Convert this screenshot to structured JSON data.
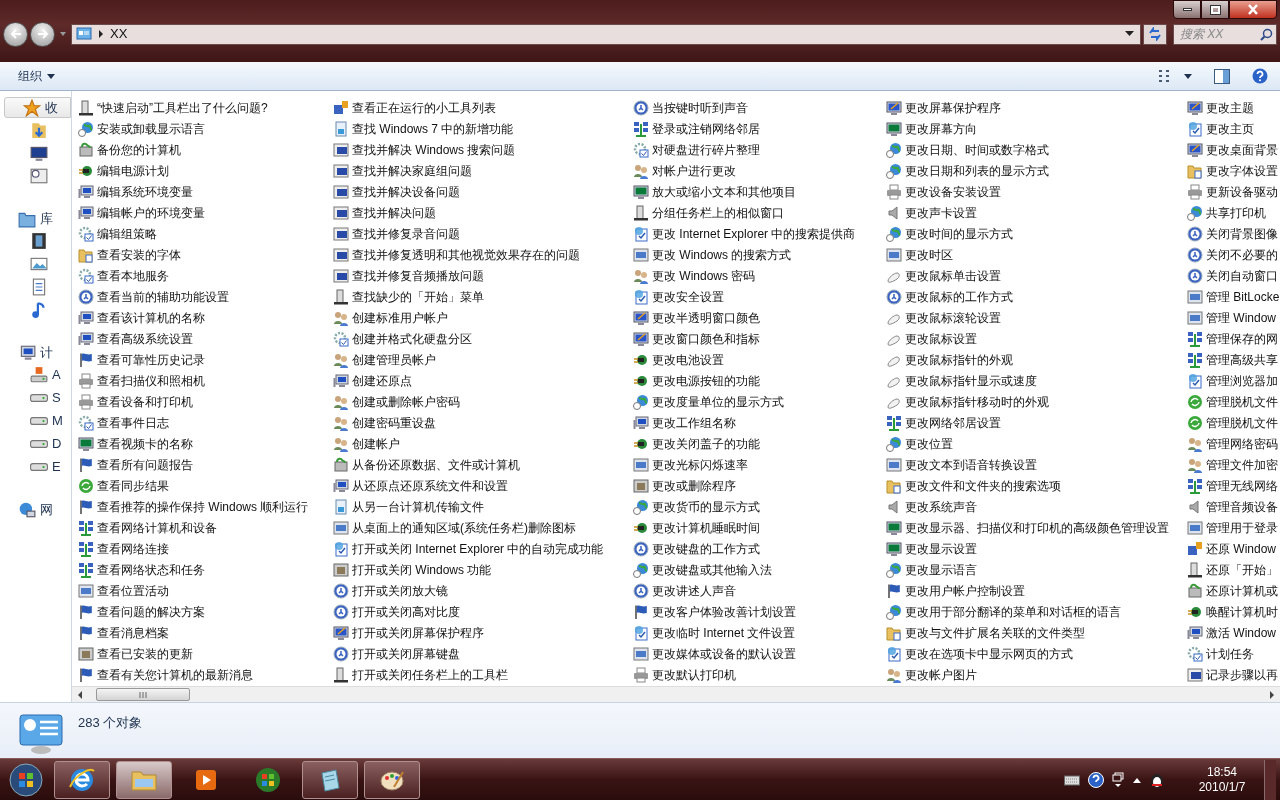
{
  "address_bar": {
    "path": "XX"
  },
  "search": {
    "placeholder": "搜索 XX"
  },
  "toolbar": {
    "organize": "组织"
  },
  "sidebar": [
    {
      "label": "收",
      "kind": "favorites",
      "selected": true,
      "children": [
        {
          "kind": "downloads"
        },
        {
          "kind": "desktop"
        },
        {
          "kind": "recent"
        }
      ]
    },
    {
      "label": "库",
      "kind": "library",
      "selected": false,
      "children": [
        {
          "kind": "videos"
        },
        {
          "kind": "pictures"
        },
        {
          "kind": "documents"
        },
        {
          "kind": "music"
        }
      ]
    },
    {
      "label": "计",
      "kind": "computer",
      "selected": false,
      "children": [
        {
          "kind": "system-drive",
          "label": "A"
        },
        {
          "kind": "drive",
          "label": "S"
        },
        {
          "kind": "drive",
          "label": "M"
        },
        {
          "kind": "drive",
          "label": "D"
        },
        {
          "kind": "drive",
          "label": "E"
        }
      ]
    },
    {
      "label": "网",
      "kind": "network",
      "selected": false
    }
  ],
  "columns": [
    [
      {
        "label": "“快速启动”工具栏出了什么问题?",
        "kind": "taskbar"
      },
      {
        "label": "安装或卸载显示语言",
        "kind": "globe"
      },
      {
        "label": "备份您的计算机",
        "kind": "backup"
      },
      {
        "label": "编辑电源计划",
        "kind": "power"
      },
      {
        "label": "编辑系统环境变量",
        "kind": "system"
      },
      {
        "label": "编辑帐户的环境变量",
        "kind": "system"
      },
      {
        "label": "编辑组策略",
        "kind": "admin"
      },
      {
        "label": "查看安装的字体",
        "kind": "folder"
      },
      {
        "label": "查看本地服务",
        "kind": "admin"
      },
      {
        "label": "查看当前的辅助功能设置",
        "kind": "access"
      },
      {
        "label": "查看该计算机的名称",
        "kind": "system"
      },
      {
        "label": "查看高级系统设置",
        "kind": "system"
      },
      {
        "label": "查看可靠性历史记录",
        "kind": "flag"
      },
      {
        "label": "查看扫描仪和照相机",
        "kind": "printer"
      },
      {
        "label": "查看设备和打印机",
        "kind": "printer"
      },
      {
        "label": "查看事件日志",
        "kind": "admin"
      },
      {
        "label": "查看视频卡的名称",
        "kind": "display"
      },
      {
        "label": "查看所有问题报告",
        "kind": "flag"
      },
      {
        "label": "查看同步结果",
        "kind": "sync"
      },
      {
        "label": "查看推荐的操作保持 Windows 顺利运行",
        "kind": "flag"
      },
      {
        "label": "查看网络计算机和设备",
        "kind": "network"
      },
      {
        "label": "查看网络连接",
        "kind": "network"
      },
      {
        "label": "查看网络状态和任务",
        "kind": "network"
      },
      {
        "label": "查看位置活动",
        "kind": "other"
      },
      {
        "label": "查看问题的解决方案",
        "kind": "flag"
      },
      {
        "label": "查看消息档案",
        "kind": "flag"
      },
      {
        "label": "查看已安装的更新",
        "kind": "programs"
      },
      {
        "label": "查看有关您计算机的最新消息",
        "kind": "flag"
      }
    ],
    [
      {
        "label": "查看正在运行的小工具列表",
        "kind": "gadgets"
      },
      {
        "label": "查找 Windows 7 中的新增功能",
        "kind": "document"
      },
      {
        "label": "查找并解决 Windows 搜索问题",
        "kind": "troubleshoot"
      },
      {
        "label": "查找并解决家庭组问题",
        "kind": "troubleshoot"
      },
      {
        "label": "查找并解决设备问题",
        "kind": "troubleshoot"
      },
      {
        "label": "查找并解决问题",
        "kind": "troubleshoot"
      },
      {
        "label": "查找并修复录音问题",
        "kind": "troubleshoot"
      },
      {
        "label": "查找并修复透明和其他视觉效果存在的问题",
        "kind": "troubleshoot"
      },
      {
        "label": "查找并修复音频播放问题",
        "kind": "troubleshoot"
      },
      {
        "label": "查找缺少的「开始」菜单",
        "kind": "taskbar"
      },
      {
        "label": "创建标准用户帐户",
        "kind": "users"
      },
      {
        "label": "创建并格式化硬盘分区",
        "kind": "admin"
      },
      {
        "label": "创建管理员帐户",
        "kind": "users"
      },
      {
        "label": "创建还原点",
        "kind": "system"
      },
      {
        "label": "创建或删除帐户密码",
        "kind": "users"
      },
      {
        "label": "创建密码重设盘",
        "kind": "users"
      },
      {
        "label": "创建帐户",
        "kind": "users"
      },
      {
        "label": "从备份还原数据、文件或计算机",
        "kind": "backup"
      },
      {
        "label": "从还原点还原系统文件和设置",
        "kind": "system"
      },
      {
        "label": "从另一台计算机传输文件",
        "kind": "document"
      },
      {
        "label": "从桌面上的通知区域(系统任务栏)删除图标",
        "kind": "other"
      },
      {
        "label": "打开或关闭 Internet Explorer 中的自动完成功能",
        "kind": "ie"
      },
      {
        "label": "打开或关闭 Windows 功能",
        "kind": "programs"
      },
      {
        "label": "打开或关闭放大镜",
        "kind": "access"
      },
      {
        "label": "打开或关闭高对比度",
        "kind": "access"
      },
      {
        "label": "打开或关闭屏幕保护程序",
        "kind": "personalize"
      },
      {
        "label": "打开或关闭屏幕键盘",
        "kind": "access"
      },
      {
        "label": "打开或关闭任务栏上的工具栏",
        "kind": "taskbar"
      }
    ],
    [
      {
        "label": "当按键时听到声音",
        "kind": "access"
      },
      {
        "label": "登录或注销网络邻居",
        "kind": "network"
      },
      {
        "label": "对硬盘进行碎片整理",
        "kind": "admin"
      },
      {
        "label": "对帐户进行更改",
        "kind": "users"
      },
      {
        "label": "放大或缩小文本和其他项目",
        "kind": "display"
      },
      {
        "label": "分组任务栏上的相似窗口",
        "kind": "taskbar"
      },
      {
        "label": "更改 Internet Explorer 中的搜索提供商",
        "kind": "ie"
      },
      {
        "label": "更改 Windows 的搜索方式",
        "kind": "other"
      },
      {
        "label": "更改 Windows 密码",
        "kind": "users"
      },
      {
        "label": "更改安全设置",
        "kind": "ie"
      },
      {
        "label": "更改半透明窗口颜色",
        "kind": "personalize"
      },
      {
        "label": "更改窗口颜色和指标",
        "kind": "personalize"
      },
      {
        "label": "更改电池设置",
        "kind": "power"
      },
      {
        "label": "更改电源按钮的功能",
        "kind": "power"
      },
      {
        "label": "更改度量单位的显示方式",
        "kind": "globe"
      },
      {
        "label": "更改工作组名称",
        "kind": "system"
      },
      {
        "label": "更改关闭盖子的功能",
        "kind": "power"
      },
      {
        "label": "更改光标闪烁速率",
        "kind": "other"
      },
      {
        "label": "更改或删除程序",
        "kind": "programs"
      },
      {
        "label": "更改货币的显示方式",
        "kind": "globe"
      },
      {
        "label": "更改计算机睡眠时间",
        "kind": "power"
      },
      {
        "label": "更改键盘的工作方式",
        "kind": "access"
      },
      {
        "label": "更改键盘或其他输入法",
        "kind": "globe"
      },
      {
        "label": "更改讲述人声音",
        "kind": "access"
      },
      {
        "label": "更改客户体验改善计划设置",
        "kind": "flag"
      },
      {
        "label": "更改临时 Internet 文件设置",
        "kind": "ie"
      },
      {
        "label": "更改媒体或设备的默认设置",
        "kind": "other"
      },
      {
        "label": "更改默认打印机",
        "kind": "printer"
      }
    ],
    [
      {
        "label": "更改屏幕保护程序",
        "kind": "personalize"
      },
      {
        "label": "更改屏幕方向",
        "kind": "display"
      },
      {
        "label": "更改日期、时间或数字格式",
        "kind": "globe"
      },
      {
        "label": "更改日期和列表的显示方式",
        "kind": "globe"
      },
      {
        "label": "更改设备安装设置",
        "kind": "printer"
      },
      {
        "label": "更改声卡设置",
        "kind": "sound"
      },
      {
        "label": "更改时间的显示方式",
        "kind": "globe"
      },
      {
        "label": "更改时区",
        "kind": "other"
      },
      {
        "label": "更改鼠标单击设置",
        "kind": "mouse"
      },
      {
        "label": "更改鼠标的工作方式",
        "kind": "access"
      },
      {
        "label": "更改鼠标滚轮设置",
        "kind": "mouse"
      },
      {
        "label": "更改鼠标设置",
        "kind": "mouse"
      },
      {
        "label": "更改鼠标指针的外观",
        "kind": "mouse"
      },
      {
        "label": "更改鼠标指针显示或速度",
        "kind": "mouse"
      },
      {
        "label": "更改鼠标指针移动时的外观",
        "kind": "mouse"
      },
      {
        "label": "更改网络邻居设置",
        "kind": "network"
      },
      {
        "label": "更改位置",
        "kind": "globe"
      },
      {
        "label": "更改文本到语音转换设置",
        "kind": "other"
      },
      {
        "label": "更改文件和文件夹的搜索选项",
        "kind": "folder"
      },
      {
        "label": "更改系统声音",
        "kind": "sound"
      },
      {
        "label": "更改显示器、扫描仪和打印机的高级颜色管理设置",
        "kind": "display"
      },
      {
        "label": "更改显示设置",
        "kind": "display"
      },
      {
        "label": "更改显示语言",
        "kind": "globe"
      },
      {
        "label": "更改用户帐户控制设置",
        "kind": "flag"
      },
      {
        "label": "更改用于部分翻译的菜单和对话框的语言",
        "kind": "globe"
      },
      {
        "label": "更改与文件扩展名关联的文件类型",
        "kind": "folder"
      },
      {
        "label": "更改在选项卡中显示网页的方式",
        "kind": "ie"
      },
      {
        "label": "更改帐户图片",
        "kind": "users"
      }
    ],
    [
      {
        "label": "更改主题",
        "kind": "personalize"
      },
      {
        "label": "更改主页",
        "kind": "ie"
      },
      {
        "label": "更改桌面背景",
        "kind": "personalize"
      },
      {
        "label": "更改字体设置",
        "kind": "folder"
      },
      {
        "label": "更新设备驱动",
        "kind": "printer"
      },
      {
        "label": "共享打印机",
        "kind": "globe"
      },
      {
        "label": "关闭背景图像",
        "kind": "access"
      },
      {
        "label": "关闭不必要的",
        "kind": "access"
      },
      {
        "label": "关闭自动窗口",
        "kind": "access"
      },
      {
        "label": "管理 BitLocke",
        "kind": "other"
      },
      {
        "label": "管理 Window",
        "kind": "other"
      },
      {
        "label": "管理保存的网",
        "kind": "network"
      },
      {
        "label": "管理高级共享",
        "kind": "network"
      },
      {
        "label": "管理浏览器加",
        "kind": "ie"
      },
      {
        "label": "管理脱机文件",
        "kind": "sync"
      },
      {
        "label": "管理脱机文件",
        "kind": "sync"
      },
      {
        "label": "管理网络密码",
        "kind": "users"
      },
      {
        "label": "管理文件加密",
        "kind": "users"
      },
      {
        "label": "管理无线网络",
        "kind": "network"
      },
      {
        "label": "管理音频设备",
        "kind": "sound"
      },
      {
        "label": "管理用于登录",
        "kind": "other"
      },
      {
        "label": "还原 Window",
        "kind": "gadgets"
      },
      {
        "label": "还原「开始」",
        "kind": "taskbar"
      },
      {
        "label": "还原计算机或",
        "kind": "backup"
      },
      {
        "label": "唤醒计算机时",
        "kind": "power"
      },
      {
        "label": "激活 Window",
        "kind": "system"
      },
      {
        "label": "计划任务",
        "kind": "admin"
      },
      {
        "label": "记录步骤以再",
        "kind": "troubleshoot"
      }
    ]
  ],
  "status": {
    "count": "283 个对象"
  },
  "taskbar": {
    "buttons": [
      {
        "kind": "ie",
        "open": true,
        "selected": false
      },
      {
        "kind": "explorer",
        "open": true,
        "selected": true
      },
      {
        "kind": "media",
        "open": false,
        "selected": false
      },
      {
        "kind": "windows",
        "open": false,
        "selected": false
      },
      {
        "kind": "notepad",
        "open": true,
        "selected": false
      },
      {
        "kind": "paint",
        "open": true,
        "selected": false
      }
    ],
    "time": "18:54",
    "date": "2010/1/7"
  }
}
